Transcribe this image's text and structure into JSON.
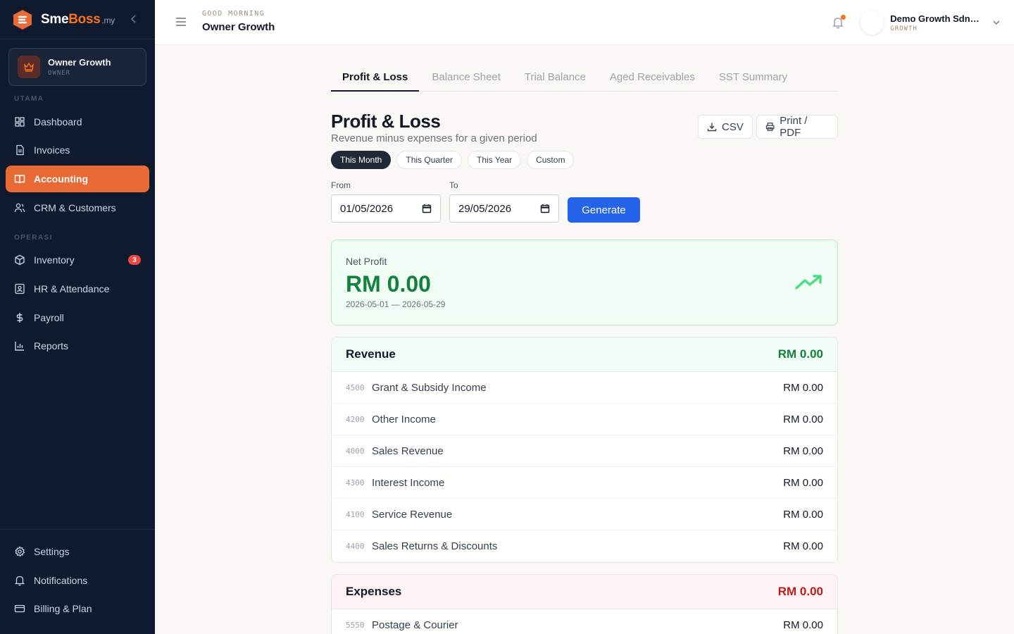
{
  "brand": {
    "name_part1": "Sme",
    "name_part2": "Boss",
    "tld": ".my"
  },
  "user": {
    "name": "Owner Growth",
    "role": "OWNER"
  },
  "sidebar": {
    "section_main": "UTAMA",
    "section_ops": "OPERASI",
    "items": [
      {
        "label": "Dashboard",
        "icon": "dashboard-icon"
      },
      {
        "label": "Invoices",
        "icon": "invoice-icon"
      },
      {
        "label": "Accounting",
        "icon": "book-icon",
        "active": true
      },
      {
        "label": "CRM & Customers",
        "icon": "users-icon"
      },
      {
        "label": "Inventory",
        "icon": "box-icon",
        "badge": "3"
      },
      {
        "label": "HR & Attendance",
        "icon": "id-card-icon"
      },
      {
        "label": "Payroll",
        "icon": "dollar-icon"
      },
      {
        "label": "Reports",
        "icon": "chart-icon"
      }
    ],
    "bottom_items": [
      {
        "label": "Settings",
        "icon": "gear-icon"
      },
      {
        "label": "Notifications",
        "icon": "bell-icon"
      },
      {
        "label": "Billing & Plan",
        "icon": "card-icon"
      }
    ]
  },
  "header": {
    "greeting": "GOOD MORNING",
    "title": "Owner Growth",
    "company_name": "Demo Growth Sdn Bhd",
    "company_plan": "GROWTH"
  },
  "tabs": [
    "Profit & Loss",
    "Balance Sheet",
    "Trial Balance",
    "Aged Receivables",
    "SST Summary"
  ],
  "page": {
    "title": "Profit & Loss",
    "subtitle": "Revenue minus expenses for a given period",
    "csv_label": "CSV",
    "print_label": "Print / PDF",
    "period_pills": [
      "This Month",
      "This Quarter",
      "This Year",
      "Custom"
    ],
    "from_label": "From",
    "from_value": "01/05/2026",
    "to_label": "To",
    "to_value": "29/05/2026",
    "generate_label": "Generate"
  },
  "net_profit": {
    "label": "Net Profit",
    "value": "RM 0.00",
    "range": "2026-05-01 — 2026-05-29"
  },
  "revenue": {
    "title": "Revenue",
    "total": "RM 0.00",
    "rows": [
      {
        "code": "4500",
        "name": "Grant & Subsidy Income",
        "amount": "RM 0.00"
      },
      {
        "code": "4200",
        "name": "Other Income",
        "amount": "RM 0.00"
      },
      {
        "code": "4000",
        "name": "Sales Revenue",
        "amount": "RM 0.00"
      },
      {
        "code": "4300",
        "name": "Interest Income",
        "amount": "RM 0.00"
      },
      {
        "code": "4100",
        "name": "Service Revenue",
        "amount": "RM 0.00"
      },
      {
        "code": "4400",
        "name": "Sales Returns & Discounts",
        "amount": "RM 0.00"
      }
    ]
  },
  "expenses": {
    "title": "Expenses",
    "total": "RM 0.00",
    "rows": [
      {
        "code": "5550",
        "name": "Postage & Courier",
        "amount": "RM 0.00"
      }
    ]
  },
  "colors": {
    "sidebar_bg": "#0f1a2e",
    "accent": "#ea6a35",
    "primary_button": "#2563eb",
    "profit_green": "#15803d",
    "expense_red": "#b91c1c"
  }
}
